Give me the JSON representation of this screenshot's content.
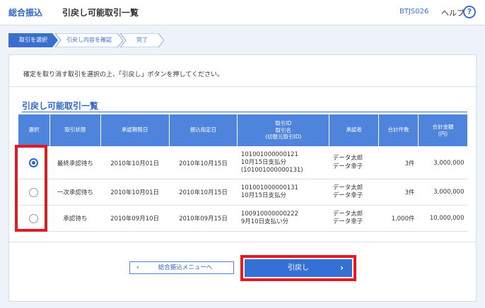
{
  "header": {
    "section_label": "総合振込",
    "page_title": "引戻し可能取引一覧",
    "screen_id": "BTJS026",
    "help_label": "ヘルプ",
    "help_icon": "?"
  },
  "steps": [
    {
      "label": "取引を選択",
      "active": true
    },
    {
      "label": "引戻し内容を確認",
      "active": false
    },
    {
      "label": "完了",
      "active": false
    }
  ],
  "instruction": "確定を取り消す取引を選択の上、「引戻し」ボタンを押してください。",
  "table": {
    "title": "引戻し可能取引一覧",
    "headers": {
      "select": "選択",
      "status": "取引状態",
      "approval_deadline": "承認期限日",
      "transfer_date": "振込指定日",
      "transaction": [
        "取引ID",
        "取引名",
        "(切替元取引ID)"
      ],
      "approver": "承認者",
      "count": "合計件数",
      "amount": [
        "合計金額",
        "(円)"
      ]
    },
    "rows": [
      {
        "selected": true,
        "status": "最終承認待ち",
        "approval_deadline": "2010年10月01日",
        "transfer_date": "2010年10月15日",
        "transaction_id": "101001000000121",
        "transaction_name": "10月15日支払分",
        "source_id": "(101001000000131)",
        "approver_1": "データ太郎",
        "approver_2": "データ幸子",
        "count": "3件",
        "amount": "3,000,000"
      },
      {
        "selected": false,
        "status": "一次承認待ち",
        "approval_deadline": "2010年10月01日",
        "transfer_date": "2010年10月15日",
        "transaction_id": "101001000000131",
        "transaction_name": "10月15日支払分",
        "source_id": "",
        "approver_1": "データ太郎",
        "approver_2": "データ幸子",
        "count": "3件",
        "amount": "3,000,000"
      },
      {
        "selected": false,
        "status": "承認待ち",
        "approval_deadline": "2010年09月10日",
        "transfer_date": "2010年09月15日",
        "transaction_id": "100910000000222",
        "transaction_name": "9月10日支払い分",
        "source_id": "",
        "approver_1": "データ太郎",
        "approver_2": "データ幸子",
        "count": "1,000件",
        "amount": "10,000,000"
      }
    ]
  },
  "buttons": {
    "back_label": "総合振込メニューへ",
    "back_icon": "chevron-left-icon",
    "submit_label": "引戻し",
    "submit_icon": "chevron-right-icon"
  },
  "colors": {
    "accent": "#2f66c7",
    "table_header": "#4f84dd",
    "highlight": "#e21b23"
  }
}
